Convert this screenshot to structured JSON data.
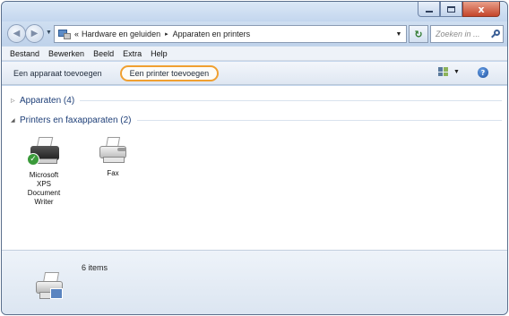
{
  "window": {
    "caption_minimize": "–",
    "caption_close": "x"
  },
  "address": {
    "crumb_prefix": "«",
    "crumbs": [
      "Hardware en geluiden",
      "Apparaten en printers"
    ],
    "separator": "▸",
    "search_placeholder": "Zoeken in ..."
  },
  "menu": {
    "items": [
      "Bestand",
      "Bewerken",
      "Beeld",
      "Extra",
      "Help"
    ]
  },
  "commands": {
    "add_device": "Een apparaat toevoegen",
    "add_printer": "Een printer toevoegen",
    "highlight_color": "#f0a030"
  },
  "groups": {
    "devices": {
      "title": "Apparaten (4)",
      "expanded": false
    },
    "printers": {
      "title": "Printers en faxapparaten (2)",
      "expanded": true
    }
  },
  "printers": [
    {
      "name": "Microsoft XPS Document Writer",
      "label_lines": [
        "Microsoft",
        "XPS",
        "Document",
        "Writer"
      ],
      "icon": "printer-default-icon",
      "is_default": true
    },
    {
      "name": "Fax",
      "label_lines": [
        "Fax"
      ],
      "icon": "fax-icon",
      "is_default": false
    }
  ],
  "details": {
    "count_text": "6 items",
    "icon": "printer-camera-icon"
  }
}
